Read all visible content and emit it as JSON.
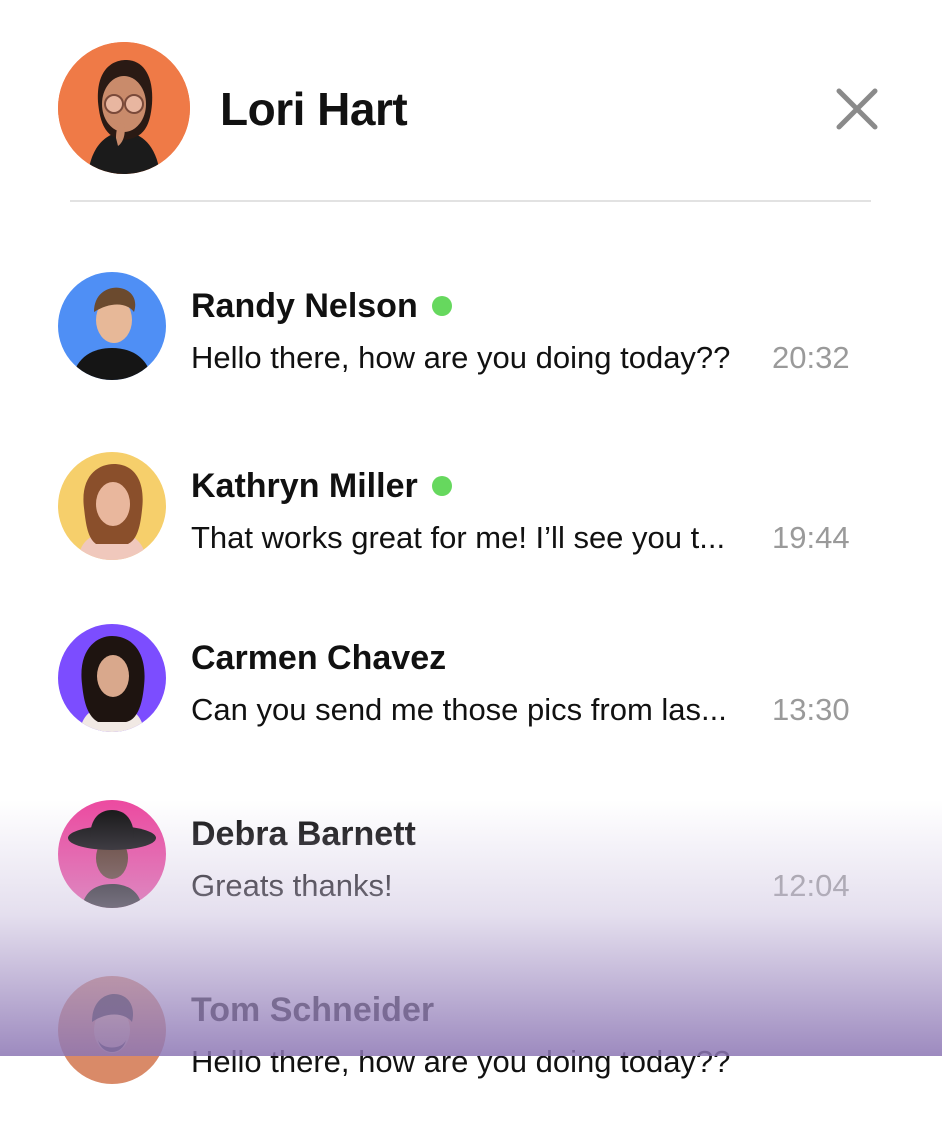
{
  "header": {
    "name": "Lori Hart",
    "avatar_color": "#ef7a47"
  },
  "conversations": [
    {
      "name": "Randy Nelson",
      "online": true,
      "message": "Hello there, how are you doing today??",
      "time": "20:32",
      "avatar_color": "#4f8ff5"
    },
    {
      "name": "Kathryn Miller",
      "online": true,
      "message": "That works great for me! I’ll see you t...",
      "time": "19:44",
      "avatar_color": "#f6cf6b"
    },
    {
      "name": "Carmen Chavez",
      "online": false,
      "message": "Can you send me those pics from las...",
      "time": "13:30",
      "avatar_color": "#7c4dff"
    },
    {
      "name": "Debra Barnett",
      "online": false,
      "message": "Greats thanks!",
      "time": "12:04",
      "avatar_color": "#ec4aa0"
    },
    {
      "name": "Tom Schneider",
      "online": false,
      "message": "Hello there, how are you doing today??",
      "time": "",
      "avatar_color": "#d98a68"
    }
  ],
  "colors": {
    "online": "#66d85e",
    "time_text": "#9a9a9a",
    "divider": "#e2e2e2"
  }
}
